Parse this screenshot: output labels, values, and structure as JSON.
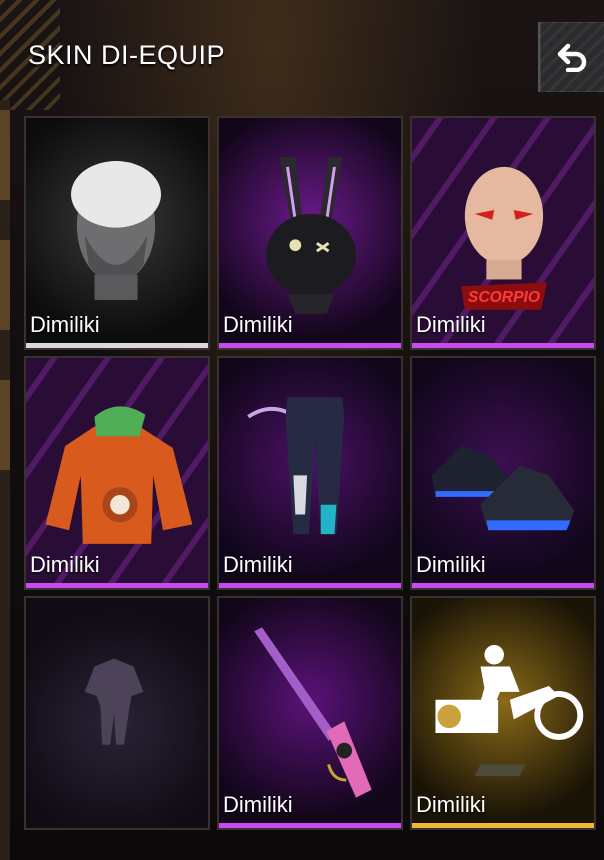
{
  "header": {
    "title": "SKIN DI-EQUIP",
    "back_icon": "undo-arrow-icon"
  },
  "colors": {
    "white_bar": "#d9d9d9",
    "purple_bar": "#c64bf0",
    "gold_bar": "#f0b83a"
  },
  "items": [
    {
      "id": "head-white-hair",
      "label": "Dimiliki",
      "icon": "head-mask-icon",
      "rarity": "white"
    },
    {
      "id": "bunny-mask",
      "label": "Dimiliki",
      "icon": "bunny-mask-icon",
      "rarity": "purple"
    },
    {
      "id": "scorpio-head",
      "label": "Dimiliki",
      "icon": "bald-head-icon",
      "rarity": "purple",
      "badge": "SCORPIO"
    },
    {
      "id": "orange-hoodie",
      "label": "Dimiliki",
      "icon": "hoodie-icon",
      "rarity": "purple"
    },
    {
      "id": "cargo-pants",
      "label": "Dimiliki",
      "icon": "pants-icon",
      "rarity": "purple"
    },
    {
      "id": "sneakers",
      "label": "Dimiliki",
      "icon": "sneakers-icon",
      "rarity": "purple"
    },
    {
      "id": "empty-outfit",
      "label": "",
      "icon": "outfit-placeholder-icon",
      "rarity": "none"
    },
    {
      "id": "pink-shotgun",
      "label": "Dimiliki",
      "icon": "shotgun-icon",
      "rarity": "purple"
    },
    {
      "id": "emote-motorbike",
      "label": "Dimiliki",
      "icon": "motorbike-emote-icon",
      "rarity": "gold"
    }
  ]
}
